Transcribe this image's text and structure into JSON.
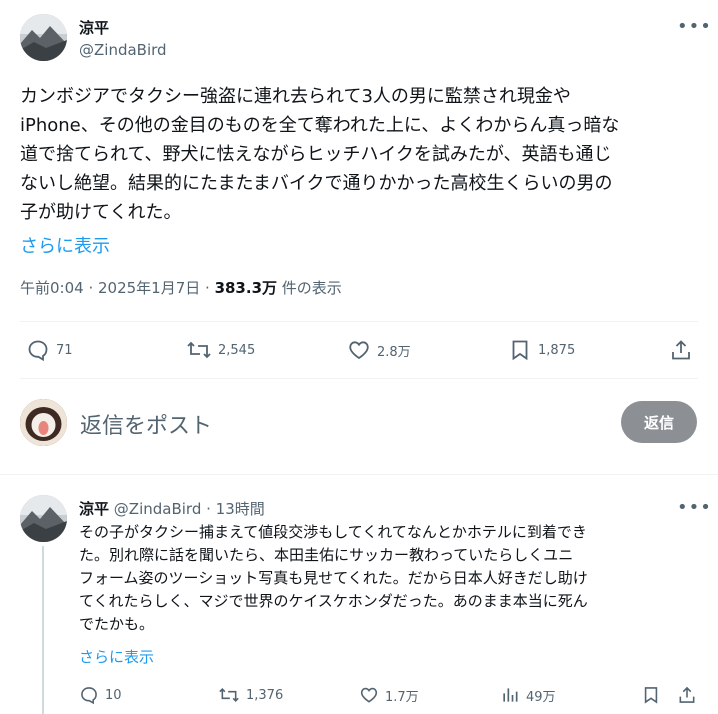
{
  "post": {
    "author_name": "涼平",
    "author_handle": "@ZindaBird",
    "more_label": "•••",
    "body_lines": [
      "カンボジアでタクシー強盗に連れ去られて3人の男に監禁され現金や",
      "iPhone、その他の金目のものを全て奪われた上に、よくわからん真っ暗な",
      "道で捨てられて、野犬に怯えながらヒッチハイクを試みたが、英語も通じ",
      "ないし絶望。結果的にたまたまバイクで通りかかった高校生くらいの男の",
      "子が助けてくれた。"
    ],
    "show_more": "さらに表示",
    "time": "午前0:04 · 2025年1月7日 · ",
    "views_count": "383.3万",
    "views_label": " 件の表示",
    "actions": {
      "replies": "71",
      "reposts": "2,545",
      "likes": "2.8万",
      "bookmarks": "1,875"
    }
  },
  "compose": {
    "placeholder": "返信をポスト",
    "button": "返信"
  },
  "reply": {
    "author_name": "涼平",
    "author_handle": "@ZindaBird",
    "time": "· 13時間",
    "more_label": "•••",
    "body_lines": [
      "その子がタクシー捕まえて値段交渉もしてくれてなんとかホテルに到着でき",
      "た。別れ際に話を聞いたら、本田圭佑にサッカー教わっていたらしくユニ",
      "フォーム姿のツーショット写真も見せてくれた。だから日本人好きだし助け",
      "てくれたらしく、マジで世界のケイスケホンダだった。あのまま本当に死ん",
      "でたかも。"
    ],
    "show_more": "さらに表示",
    "actions": {
      "replies": "10",
      "reposts": "1,376",
      "likes": "1.7万",
      "views": "49万"
    }
  },
  "colors": {
    "link": "#1d9bf0",
    "secondary_text": "#536471",
    "reply_button_bg": "#8c9094"
  }
}
